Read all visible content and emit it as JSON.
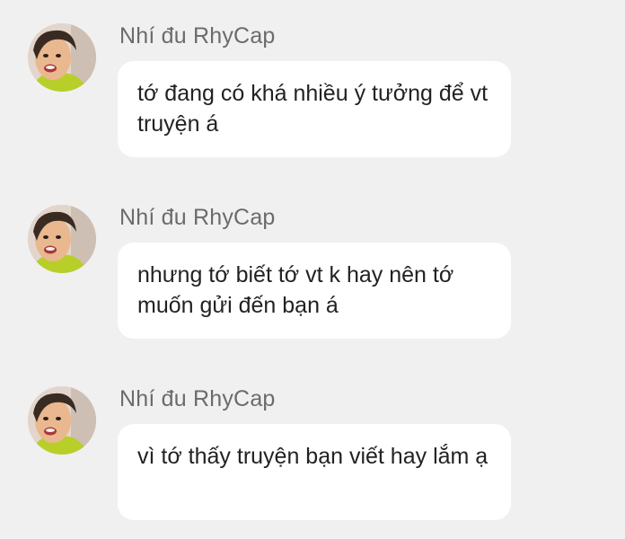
{
  "messages": [
    {
      "sender": "Nhí đu RhyCap",
      "text": "tớ đang có khá nhiều ý tưởng để vt truyện á"
    },
    {
      "sender": "Nhí đu RhyCap",
      "text": "nhưng tớ biết tớ vt k hay nên tớ muốn gửi đến bạn á"
    },
    {
      "sender": "Nhí đu RhyCap",
      "text": "vì tớ thấy truyện bạn viết hay lắm ạ"
    }
  ],
  "colors": {
    "background": "#f0f0f0",
    "bubble": "#ffffff",
    "sender_text": "#6b6b6b",
    "message_text": "#222222"
  },
  "icons": {
    "avatar": "user-avatar-photo"
  }
}
